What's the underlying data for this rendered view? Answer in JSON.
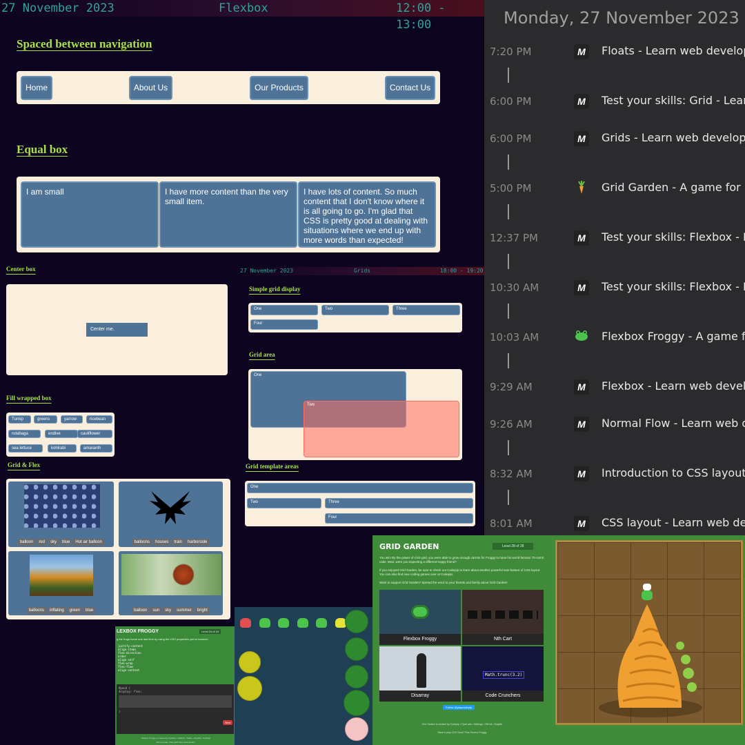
{
  "flexbox_header": {
    "date": "27 November 2023",
    "title": "Flexbox",
    "time": "12:00 - 13:00"
  },
  "spaced_nav": {
    "heading": "Spaced between navigation",
    "items": [
      "Home",
      "About Us",
      "Our Products",
      "Contact Us"
    ]
  },
  "equal_box": {
    "heading": "Equal box",
    "boxes": [
      "I am small",
      "I have more content than the very small item.",
      "I have lots of content. So much content that I don't know where it is all going to go. I'm glad that CSS is pretty good at dealing with situations where we end up with more words than expected!"
    ]
  },
  "center_box": {
    "heading": "Center box",
    "label": "Center me."
  },
  "fill_wrapped": {
    "heading": "Fill wrapped box",
    "items": [
      "Turnip",
      "greens",
      "yarrow",
      "ricebean",
      "rutabaga",
      "endive",
      "cauliflower",
      "sea lettuce",
      "kohlrabi",
      "amaranth"
    ]
  },
  "grid_flex": {
    "heading": "Grid & Flex",
    "cards": [
      {
        "image": "blueberries",
        "tags": [
          "balloon",
          "red",
          "sky",
          "blue",
          "Hot air balloon"
        ]
      },
      {
        "image": "black-bird-silhouette",
        "tags": [
          "balloons",
          "houses",
          "train",
          "harborside"
        ]
      },
      {
        "image": "autumn-trees",
        "tags": [
          "balloons",
          "inflating",
          "green",
          "blue"
        ]
      },
      {
        "image": "red-panda",
        "tags": [
          "balloon",
          "sun",
          "sky",
          "summer",
          "bright"
        ]
      }
    ]
  },
  "grids_header": {
    "date": "27 November 2023",
    "title": "Grids",
    "time": "18:00 - 19:20"
  },
  "simple_grid": {
    "heading": "Simple grid display",
    "cells": [
      "One",
      "Two",
      "Three",
      "Four"
    ]
  },
  "grid_area": {
    "heading": "Grid area",
    "cells": [
      "One",
      "Two"
    ],
    "overlap_color": "#ff6f61"
  },
  "grid_template": {
    "heading": "Grid template areas",
    "cells": [
      "One",
      "Two",
      "Three",
      "Four"
    ]
  },
  "history": {
    "date_heading": "Monday, 27 November 2023",
    "entries": [
      {
        "time": "7:20 PM",
        "icon": "mdn-icon",
        "title": "Floats - Learn web develop"
      },
      {
        "time": "6:00 PM",
        "icon": "mdn-icon",
        "title": "Test your skills: Grid - Learn"
      },
      {
        "time": "6:00 PM",
        "icon": "mdn-icon",
        "title": "Grids - Learn web develop"
      },
      {
        "time": "5:00 PM",
        "icon": "carrot-icon",
        "title": "Grid Garden - A game for l"
      },
      {
        "time": "12:37 PM",
        "icon": "mdn-icon",
        "title": "Test your skills: Flexbox - Le"
      },
      {
        "time": "10:30 AM",
        "icon": "mdn-icon",
        "title": "Test your skills: Flexbox - Le"
      },
      {
        "time": "10:03 AM",
        "icon": "frog-icon",
        "title": "Flexbox Froggy - A game fo"
      },
      {
        "time": "9:29 AM",
        "icon": "mdn-icon",
        "title": "Flexbox - Learn web develo"
      },
      {
        "time": "9:26 AM",
        "icon": "mdn-icon",
        "title": "Normal Flow - Learn web d"
      },
      {
        "time": "8:32 AM",
        "icon": "mdn-icon",
        "title": "Introduction to CSS layout"
      },
      {
        "time": "8:01 AM",
        "icon": "mdn-icon",
        "title": "CSS layout - Learn web de"
      }
    ],
    "mdn_glyph": "M"
  },
  "froggy": {
    "title": "LEXBOX FROGGY",
    "level": "Level 24 of 24",
    "intro": "g the frogs home one last time by using the CSS properties you've learned:",
    "props": [
      "justify-content",
      "align-items",
      "flex-direction",
      "order",
      "align-self",
      "flex-wrap",
      "flex-flow",
      "align-content"
    ],
    "code": [
      "#pond {",
      "  display: flex;",
      "}"
    ],
    "next": "Next",
    "footer": "Flexbox Froggy is created by Codepip • GitHub • Twitter • English • Settings",
    "footer2": "Want to learn CSS grid? Play Grid Garden."
  },
  "garden": {
    "title": "GRID GARDEN",
    "level": "Level 28 of 28",
    "text1": "You win! By the power of CSS grid, you were able to grow enough carrots for Froggy to have his world famous 70-carrot cake. Wait, were you expecting a different hoppy friend?",
    "text2": "If you enjoyed Grid Garden, be sure to check out Codepip to learn about another powerful new feature of CSS layout. You can also find new coding games over at Codepip.",
    "text3": "Want to support Grid Garden? Spread the word to your friends and family about Grid Garden!",
    "games": [
      "Flexbox Froggy",
      "Nth Cart",
      "Disarray",
      "Code Crunchers"
    ],
    "follow": "Follow @playcodepip",
    "code_sample": "Math.trunc(3.2)",
    "footer": "Grid Garden is created by Codepip • Tips/Labs • Settings • GitHub • English",
    "footer2": "Want to play CSS Tarot? Plus Flexbox Froggy"
  }
}
